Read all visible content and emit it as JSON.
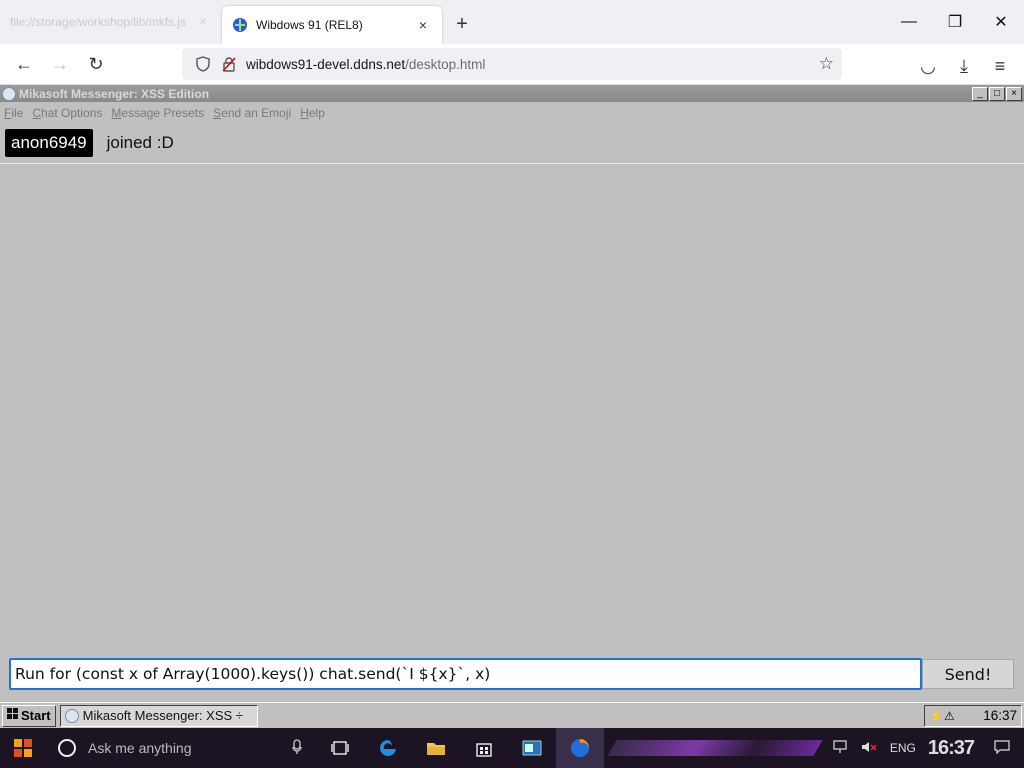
{
  "browser": {
    "tabs": [
      {
        "title": "file://storage/workshop/lib/mkfs.js",
        "close_icon": "×",
        "active": false
      },
      {
        "title": "Wibdows 91 (REL8)",
        "close_icon": "×",
        "active": true
      }
    ],
    "new_tab_label": "+",
    "window_controls": {
      "minimize": "—",
      "restore": "❐",
      "close": "✕"
    },
    "nav": {
      "back": "←",
      "forward": "→",
      "reload": "↻"
    },
    "url": {
      "host": "wibdows91-devel.ddns.net",
      "path": "/desktop.html"
    },
    "toolbar_icons": {
      "pocket": "◡",
      "download": "⤓",
      "menu": "≡",
      "bookmark": "☆"
    }
  },
  "messenger": {
    "title": "Mikasoft Messenger: XSS Edition",
    "window_controls": {
      "minimize": "_",
      "maximize": "□",
      "close": "×"
    },
    "menu": [
      {
        "key": "F",
        "rest": "ile"
      },
      {
        "key": "C",
        "rest": "hat Options"
      },
      {
        "key": "M",
        "rest": "essage Presets"
      },
      {
        "key": "S",
        "rest": "end an Emoji"
      },
      {
        "key": "H",
        "rest": "elp"
      }
    ],
    "messages": [
      {
        "user": "anon6949",
        "text": "joined :D"
      }
    ],
    "input_value": "Run for (const x of Array(1000).keys()) chat.send(`I ${x}`, x)",
    "send_label": "Send!"
  },
  "w91_taskbar": {
    "start_label": "Start",
    "task_label": "Mikasoft Messenger: XSS ÷",
    "tray_icons": "⚡⚠",
    "clock": "16:37"
  },
  "os_taskbar": {
    "search_placeholder": "Ask me anything",
    "tray_lang": "ENG",
    "clock": "16:37"
  },
  "colors": {
    "accent_input_border": "#1e74d8",
    "user_badge_bg": "#000000",
    "w91_gray": "#c0c0c0"
  }
}
